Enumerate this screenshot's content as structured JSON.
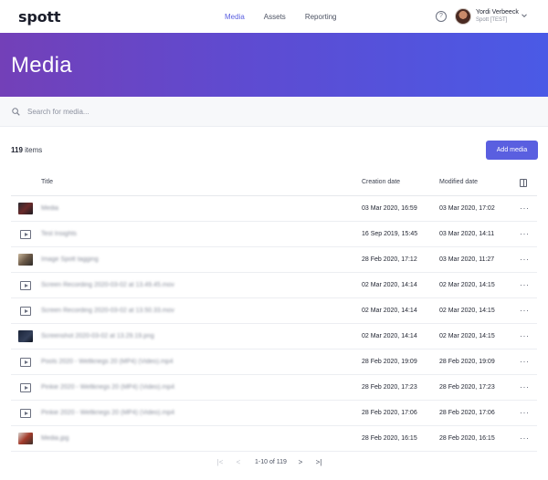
{
  "app": {
    "logo": "spott"
  },
  "nav": {
    "items": [
      "Media",
      "Assets",
      "Reporting"
    ],
    "active": "Media"
  },
  "user": {
    "name": "Yordi Verbeeck",
    "org": "Spott [TEST]"
  },
  "hero": {
    "title": "Media"
  },
  "search": {
    "placeholder": "Search for media..."
  },
  "toolbar": {
    "count": "119",
    "count_suffix": " items",
    "add_label": "Add media"
  },
  "table": {
    "columns": [
      "Title",
      "Creation date",
      "Modified date"
    ],
    "rows": [
      {
        "thumb": "image-dark-car",
        "title": "Media",
        "created": "03 Mar 2020, 16:59",
        "modified": "03 Mar 2020, 17:02"
      },
      {
        "thumb": "video-icon",
        "title": "Test Insights",
        "created": "16 Sep 2019, 15:45",
        "modified": "03 Mar 2020, 14:11"
      },
      {
        "thumb": "image-people",
        "title": "Image Spott tagging",
        "created": "28 Feb 2020, 17:12",
        "modified": "03 Mar 2020, 11:27"
      },
      {
        "thumb": "video-icon",
        "title": "Screen Recording 2020-03-02 at 13.49.45.mov",
        "created": "02 Mar 2020, 14:14",
        "modified": "02 Mar 2020, 14:15"
      },
      {
        "thumb": "video-icon",
        "title": "Screen Recording 2020-03-02 at 13.50.33.mov",
        "created": "02 Mar 2020, 14:14",
        "modified": "02 Mar 2020, 14:15"
      },
      {
        "thumb": "image-dark-screen",
        "title": "Screenshot 2020-03-02 at 13.29.19.png",
        "created": "02 Mar 2020, 14:14",
        "modified": "02 Mar 2020, 14:15"
      },
      {
        "thumb": "video-icon",
        "title": "Pools 2020 - Weltkriegs 20 (MP4) (Video).mp4",
        "created": "28 Feb 2020, 19:09",
        "modified": "28 Feb 2020, 19:09"
      },
      {
        "thumb": "video-icon",
        "title": "Pinkie 2020 - Weltkriegs 20 (MP4) (Video).mp4",
        "created": "28 Feb 2020, 17:23",
        "modified": "28 Feb 2020, 17:23"
      },
      {
        "thumb": "video-icon",
        "title": "Pinkie 2020 - Weltkriegs 20 (MP4) (Video).mp4",
        "created": "28 Feb 2020, 17:06",
        "modified": "28 Feb 2020, 17:06"
      },
      {
        "thumb": "image-red-car",
        "title": "Media.jpg",
        "created": "28 Feb 2020, 16:15",
        "modified": "28 Feb 2020, 16:15"
      }
    ]
  },
  "pagination": {
    "range": "1-10 of 119",
    "first": "|<",
    "prev": "<",
    "next": ">",
    "last": ">|"
  },
  "colors": {
    "accent": "#5a5fe0",
    "hero_start": "#7340b8",
    "hero_end": "#4a5ae6"
  }
}
